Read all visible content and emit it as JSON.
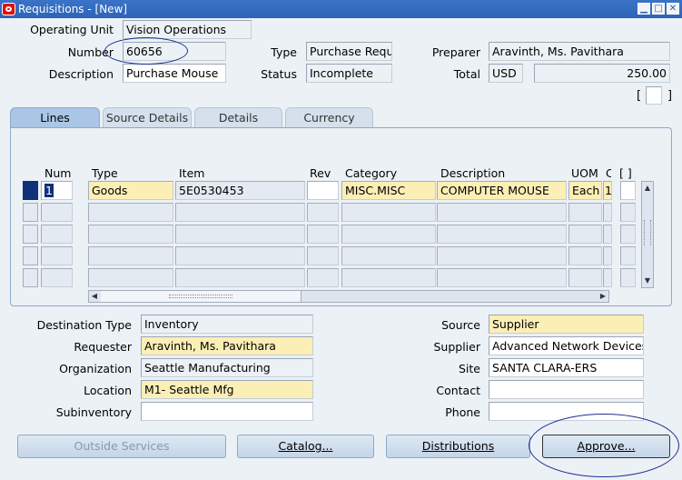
{
  "window": {
    "title": "Requisitions - [New]",
    "controls": [
      "minimize-icon",
      "maximize-icon",
      "close-icon"
    ]
  },
  "header": {
    "operating_unit_label": "Operating Unit",
    "operating_unit_value": "Vision Operations",
    "number_label": "Number",
    "number_value": "60656",
    "type_label": "Type",
    "type_value": "Purchase Requi",
    "preparer_label": "Preparer",
    "preparer_value": "Aravinth, Ms. Pavithara",
    "description_label": "Description",
    "description_value": "Purchase Mouse",
    "status_label": "Status",
    "status_value": "Incomplete",
    "total_label": "Total",
    "currency_value": "USD",
    "total_value": "250.00",
    "dff_brackets": "[ ]"
  },
  "tabs": [
    {
      "label": "Lines",
      "active": true
    },
    {
      "label": "Source Details",
      "active": false
    },
    {
      "label": "Details",
      "active": false
    },
    {
      "label": "Currency",
      "active": false
    }
  ],
  "lines": {
    "columns": [
      "Num",
      "Type",
      "Item",
      "Rev",
      "Category",
      "Description",
      "UOM",
      "C",
      "[ ]"
    ],
    "rows": [
      {
        "num": "1",
        "type": "Goods",
        "item": "5E0530453",
        "rev": "",
        "category": "MISC.MISC",
        "description": "COMPUTER MOUSE",
        "uom": "Each",
        "c": "1"
      },
      {
        "num": "",
        "type": "",
        "item": "",
        "rev": "",
        "category": "",
        "description": "",
        "uom": "",
        "c": ""
      },
      {
        "num": "",
        "type": "",
        "item": "",
        "rev": "",
        "category": "",
        "description": "",
        "uom": "",
        "c": ""
      },
      {
        "num": "",
        "type": "",
        "item": "",
        "rev": "",
        "category": "",
        "description": "",
        "uom": "",
        "c": ""
      },
      {
        "num": "",
        "type": "",
        "item": "",
        "rev": "",
        "category": "",
        "description": "",
        "uom": "",
        "c": ""
      }
    ]
  },
  "details": {
    "destination_type_label": "Destination Type",
    "destination_type_value": "Inventory",
    "requester_label": "Requester",
    "requester_value": "Aravinth, Ms. Pavithara",
    "organization_label": "Organization",
    "organization_value": "Seattle Manufacturing",
    "location_label": "Location",
    "location_value": "M1- Seattle Mfg",
    "subinventory_label": "Subinventory",
    "subinventory_value": "",
    "source_label": "Source",
    "source_value": "Supplier",
    "supplier_label": "Supplier",
    "supplier_value": "Advanced Network Devices",
    "site_label": "Site",
    "site_value": "SANTA CLARA-ERS",
    "contact_label": "Contact",
    "contact_value": "",
    "phone_label": "Phone",
    "phone_value": ""
  },
  "buttons": {
    "outside_services": "Outside Services",
    "catalog": "Catalog...",
    "distributions": "Distributions",
    "approve": "Approve..."
  },
  "colors": {
    "title_bar": "#3a73c7",
    "required_field": "#fcefb6",
    "current_row": "#11307a",
    "annotation": "#1f2f8f"
  }
}
